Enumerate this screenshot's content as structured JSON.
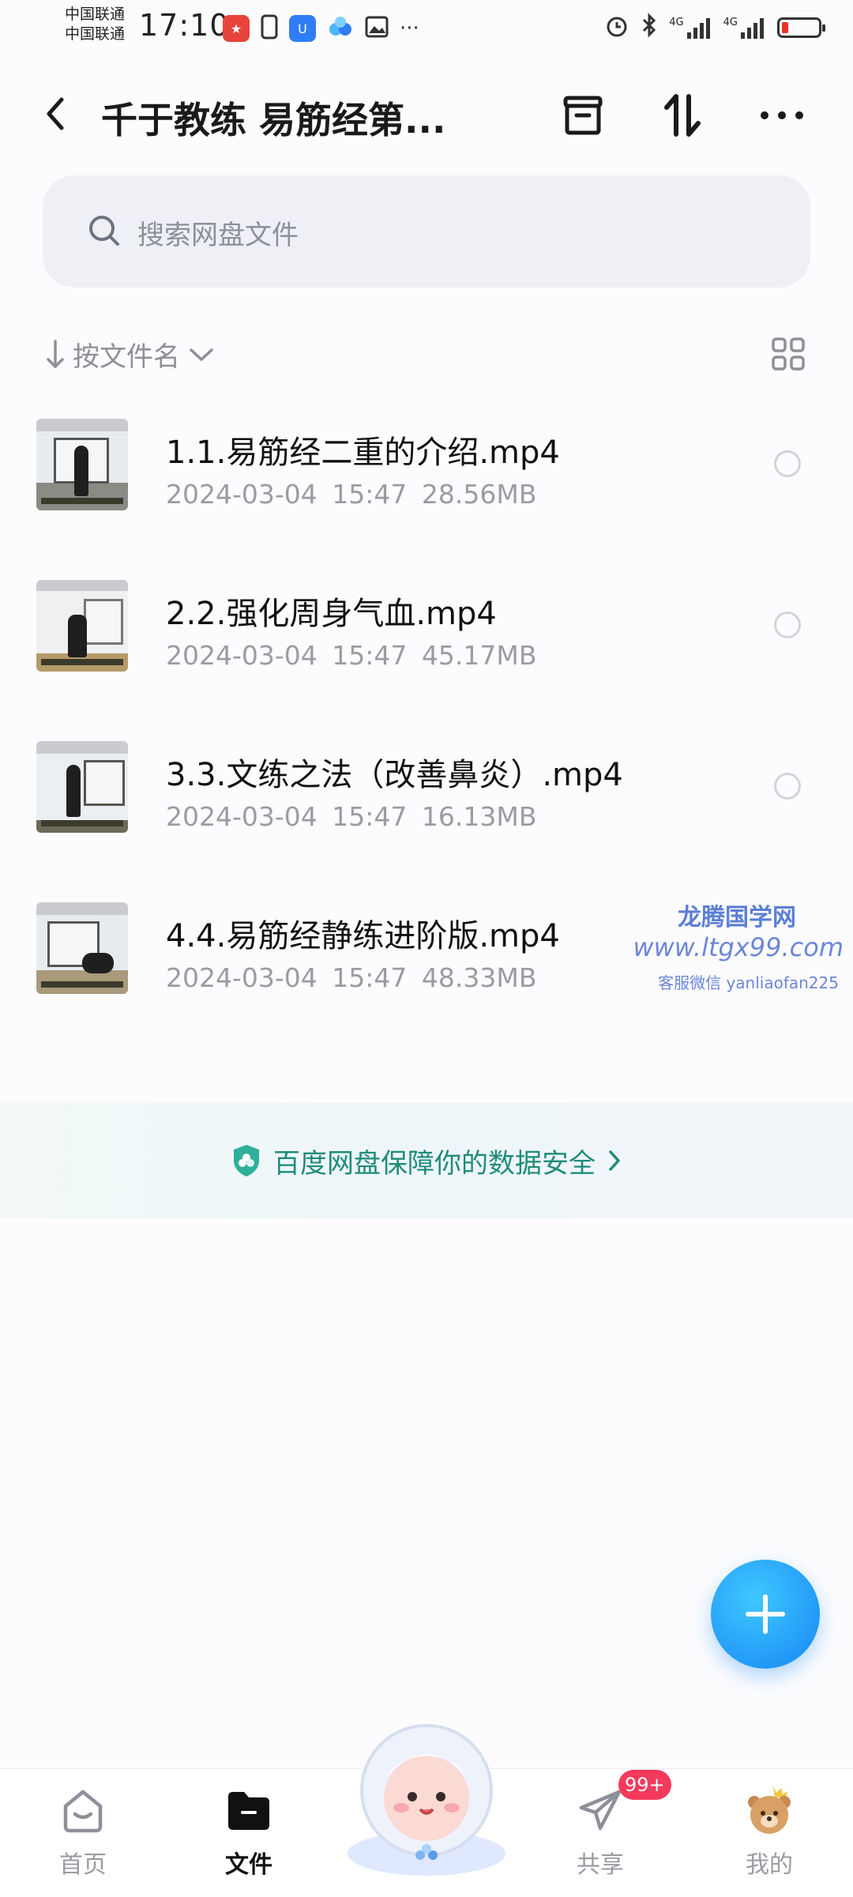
{
  "status_bar": {
    "carrier_1": "中国联通",
    "carrier_2": "中国联通",
    "time": "17:10",
    "network_1": "4G",
    "network_2": "4G"
  },
  "header": {
    "title": "千于教练 易筋经第..."
  },
  "search": {
    "placeholder": "搜索网盘文件"
  },
  "sort": {
    "label": "按文件名"
  },
  "files": [
    {
      "name": "1.1.易筋经二重的介绍.mp4",
      "date": "2024-03-04",
      "time": "15:47",
      "size": "28.56MB"
    },
    {
      "name": "2.2.强化周身气血.mp4",
      "date": "2024-03-04",
      "time": "15:47",
      "size": "45.17MB"
    },
    {
      "name": "3.3.文练之法（改善鼻炎）.mp4",
      "date": "2024-03-04",
      "time": "15:47",
      "size": "16.13MB"
    },
    {
      "name": "4.4.易筋经静练进阶版.mp4",
      "date": "2024-03-04",
      "time": "15:47",
      "size": "48.33MB"
    }
  ],
  "watermark": {
    "title": "龙腾国学网",
    "url": "www.ltgx99.com",
    "wechat": "客服微信 yanliaofan225"
  },
  "security_banner": {
    "text": "百度网盘保障你的数据安全"
  },
  "bottom_nav": {
    "home": "首页",
    "files": "文件",
    "share": "共享",
    "share_badge": "99+",
    "mine": "我的"
  },
  "colors": {
    "accent": "#1687f3",
    "security": "#1f8c7a",
    "badge": "#f43a5c"
  }
}
